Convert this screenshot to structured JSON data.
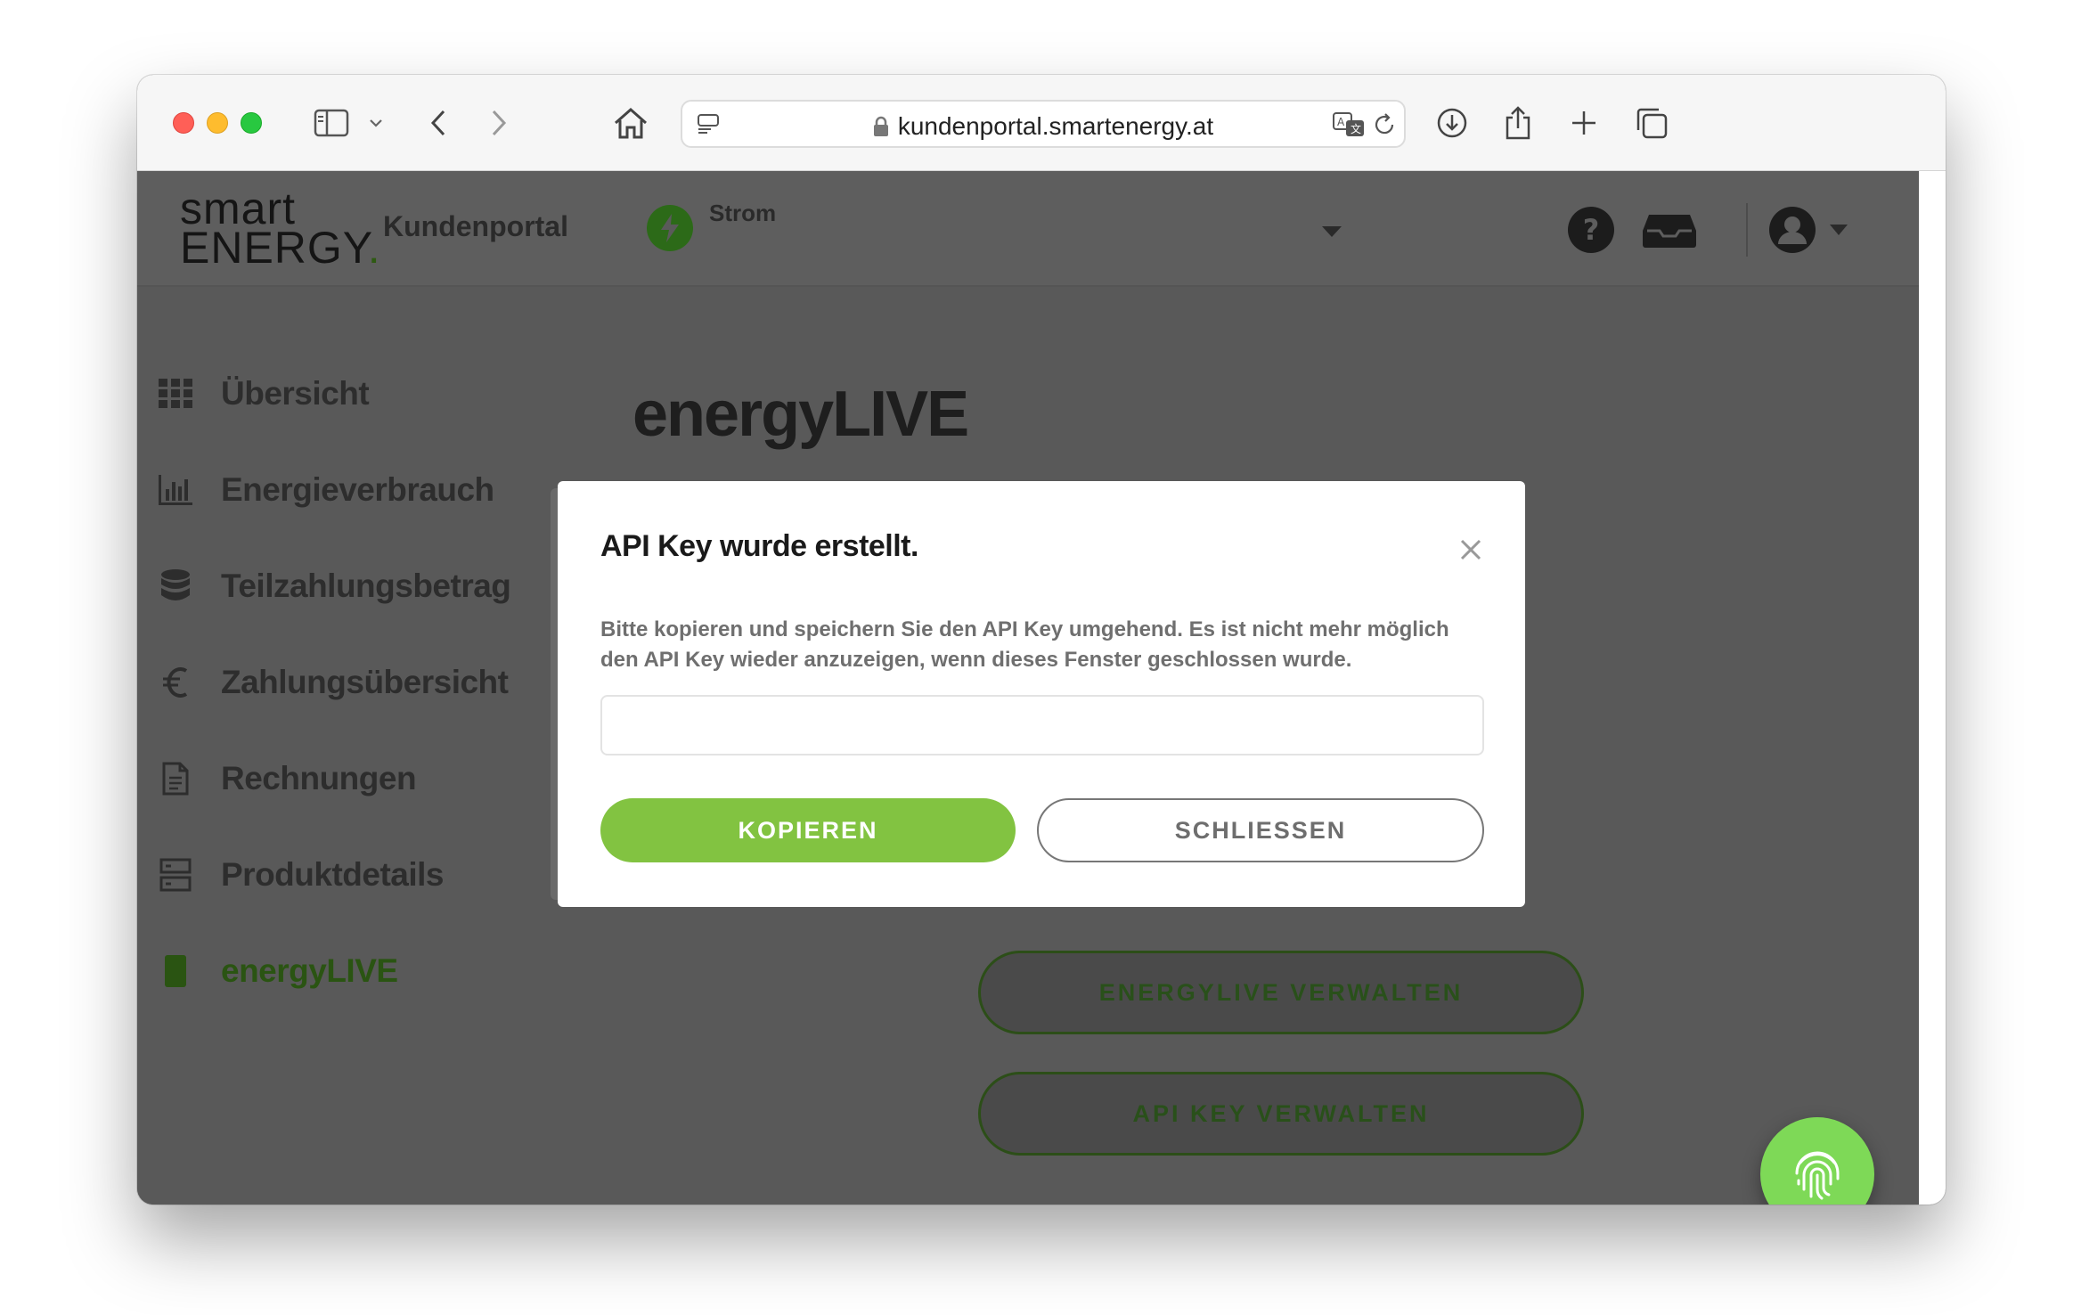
{
  "browser": {
    "url": "kundenportal.smartenergy.at",
    "icons": [
      "sidebar-icon",
      "chevron-down-icon",
      "back-icon",
      "forward-icon",
      "home-icon",
      "reader-icon",
      "lock-icon",
      "translate-icon",
      "reload-icon",
      "download-icon",
      "share-icon",
      "new-tab-icon",
      "tab-overview-icon"
    ]
  },
  "header": {
    "logo_line1": "smart",
    "logo_line2": "ENERGY",
    "logo_dot": ".",
    "portal_label": "Kundenportal",
    "product_label": "Strom"
  },
  "sidebar": {
    "items": [
      {
        "label": "Übersicht",
        "icon": "grid-icon"
      },
      {
        "label": "Energieverbrauch",
        "icon": "bar-chart-icon"
      },
      {
        "label": "Teilzahlungsbetrag",
        "icon": "database-icon"
      },
      {
        "label": "Zahlungsübersicht",
        "icon": "euro-icon"
      },
      {
        "label": "Rechnungen",
        "icon": "document-icon"
      },
      {
        "label": "Produktdetails",
        "icon": "server-icon"
      },
      {
        "label": "energyLIVE",
        "icon": "device-icon"
      }
    ]
  },
  "main": {
    "title": "energyLIVE",
    "manage_energylive_label": "ENERGYLIVE VERWALTEN",
    "manage_api_key_label": "API KEY VERWALTEN"
  },
  "modal": {
    "title": "API Key wurde erstellt.",
    "message": "Bitte kopieren und speichern Sie den API Key umgehend. Es ist nicht mehr möglich den API Key wieder anzuzeigen, wenn dieses Fenster geschlossen wurde.",
    "api_key_value": "",
    "copy_label": "KOPIEREN",
    "close_label": "SCHLIESSEN"
  },
  "colors": {
    "brand_green": "#82c341",
    "fab_green": "#7ed957",
    "overlay_gray": "#595959"
  }
}
